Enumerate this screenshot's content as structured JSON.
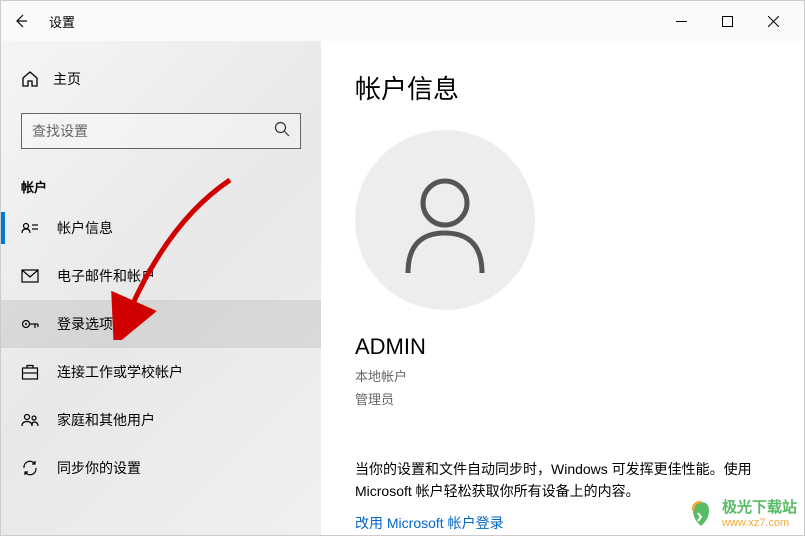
{
  "titlebar": {
    "title": "设置"
  },
  "sidebar": {
    "home_label": "主页",
    "search_placeholder": "查找设置",
    "section_label": "帐户",
    "items": [
      {
        "label": "帐户信息"
      },
      {
        "label": "电子邮件和帐户"
      },
      {
        "label": "登录选项"
      },
      {
        "label": "连接工作或学校帐户"
      },
      {
        "label": "家庭和其他用户"
      },
      {
        "label": "同步你的设置"
      }
    ]
  },
  "main": {
    "heading": "帐户信息",
    "user_name": "ADMIN",
    "account_type": "本地帐户",
    "role": "管理员",
    "sync_text": "当你的设置和文件自动同步时，Windows 可发挥更佳性能。使用 Microsoft 帐户轻松获取你所有设备上的内容。",
    "link_text": "改用 Microsoft 帐户登录"
  },
  "watermark": {
    "title": "极光下载站",
    "url": "www.xz7.com"
  }
}
